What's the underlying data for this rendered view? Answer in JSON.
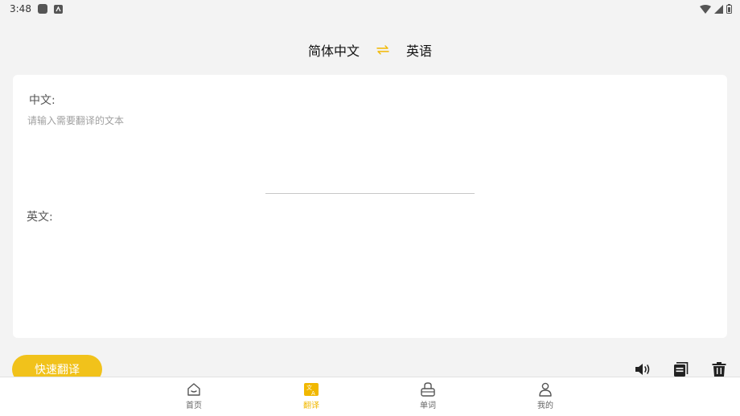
{
  "status_bar": {
    "time": "3:48"
  },
  "language_bar": {
    "source_language": "简体中文",
    "target_language": "英语"
  },
  "source": {
    "label": "中文:",
    "placeholder": "请输入需要翻译的文本",
    "value": ""
  },
  "target": {
    "label": "英文:",
    "value": ""
  },
  "actions": {
    "translate_label": "快速翻译"
  },
  "bottom_nav": {
    "items": [
      {
        "label": "首页",
        "icon": "home-icon"
      },
      {
        "label": "翻译",
        "icon": "translate-icon",
        "active": true
      },
      {
        "label": "单词",
        "icon": "words-icon"
      },
      {
        "label": "我的",
        "icon": "profile-icon"
      }
    ]
  },
  "colors": {
    "accent": "#f1c21b",
    "background": "#f3f3f3",
    "card": "#ffffff"
  }
}
